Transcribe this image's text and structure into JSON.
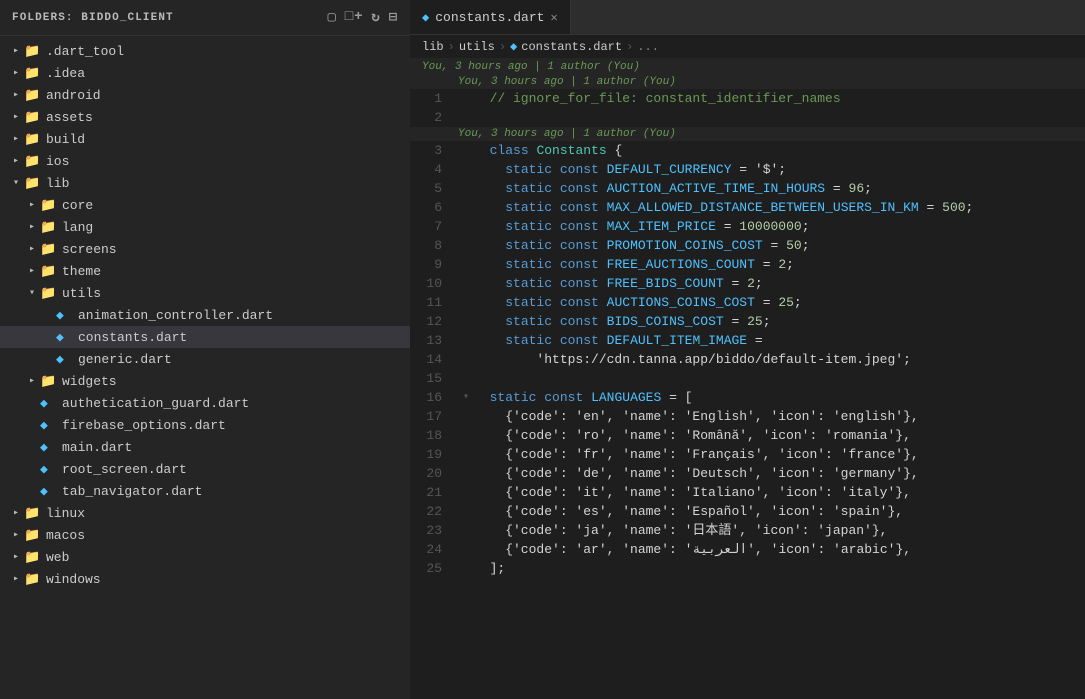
{
  "sidebar": {
    "header": "FOLDERS: BIDDO_CLIENT",
    "icons": [
      "new-file",
      "new-folder",
      "refresh",
      "collapse"
    ],
    "items": [
      {
        "id": "dart_tool",
        "label": ".dart_tool",
        "type": "folder",
        "level": 0,
        "expanded": false,
        "icon": "folder-yellow"
      },
      {
        "id": "idea",
        "label": ".idea",
        "type": "folder",
        "level": 0,
        "expanded": false,
        "icon": "folder-yellow"
      },
      {
        "id": "android",
        "label": "android",
        "type": "folder",
        "level": 0,
        "expanded": false,
        "icon": "folder-green"
      },
      {
        "id": "assets",
        "label": "assets",
        "type": "folder",
        "level": 0,
        "expanded": false,
        "icon": "folder-orange"
      },
      {
        "id": "build",
        "label": "build",
        "type": "folder",
        "level": 0,
        "expanded": false,
        "icon": "folder-yellow"
      },
      {
        "id": "ios",
        "label": "ios",
        "type": "folder",
        "level": 0,
        "expanded": false,
        "icon": "folder-blue"
      },
      {
        "id": "lib",
        "label": "lib",
        "type": "folder",
        "level": 0,
        "expanded": true,
        "icon": "folder-yellow"
      },
      {
        "id": "core",
        "label": "core",
        "type": "folder",
        "level": 1,
        "expanded": false,
        "icon": "folder-yellow"
      },
      {
        "id": "lang",
        "label": "lang",
        "type": "folder",
        "level": 1,
        "expanded": false,
        "icon": "folder-orange"
      },
      {
        "id": "screens",
        "label": "screens",
        "type": "folder",
        "level": 1,
        "expanded": false,
        "icon": "folder-orange"
      },
      {
        "id": "theme",
        "label": "theme",
        "type": "folder",
        "level": 1,
        "expanded": false,
        "icon": "folder-orange"
      },
      {
        "id": "utils",
        "label": "utils",
        "type": "folder",
        "level": 1,
        "expanded": true,
        "icon": "folder-orange"
      },
      {
        "id": "animation_controller",
        "label": "animation_controller.dart",
        "type": "file",
        "level": 2,
        "icon": "dart"
      },
      {
        "id": "constants",
        "label": "constants.dart",
        "type": "file",
        "level": 2,
        "icon": "dart",
        "active": true
      },
      {
        "id": "generic",
        "label": "generic.dart",
        "type": "file",
        "level": 2,
        "icon": "dart"
      },
      {
        "id": "widgets",
        "label": "widgets",
        "type": "folder",
        "level": 1,
        "expanded": false,
        "icon": "folder-orange"
      },
      {
        "id": "authetication_guard",
        "label": "authetication_guard.dart",
        "type": "file",
        "level": 1,
        "icon": "dart"
      },
      {
        "id": "firebase_options",
        "label": "firebase_options.dart",
        "type": "file",
        "level": 1,
        "icon": "dart"
      },
      {
        "id": "main",
        "label": "main.dart",
        "type": "file",
        "level": 1,
        "icon": "dart"
      },
      {
        "id": "root_screen",
        "label": "root_screen.dart",
        "type": "file",
        "level": 1,
        "icon": "dart"
      },
      {
        "id": "tab_navigator",
        "label": "tab_navigator.dart",
        "type": "file",
        "level": 1,
        "icon": "dart"
      },
      {
        "id": "linux",
        "label": "linux",
        "type": "folder",
        "level": 0,
        "expanded": false,
        "icon": "folder-yellow"
      },
      {
        "id": "macos",
        "label": "macos",
        "type": "folder",
        "level": 0,
        "expanded": false,
        "icon": "folder-yellow"
      },
      {
        "id": "web",
        "label": "web",
        "type": "folder",
        "level": 0,
        "expanded": false,
        "icon": "folder-blue"
      },
      {
        "id": "windows",
        "label": "windows",
        "type": "folder",
        "level": 0,
        "expanded": false,
        "icon": "folder-yellow"
      }
    ]
  },
  "editor": {
    "tab_name": "constants.dart",
    "breadcrumb": [
      "lib",
      "utils",
      "constants.dart",
      "..."
    ],
    "blame": "You, 3 hours ago | 1 author (You)",
    "blame2": "You, 3 hours ago | 1 author (You)",
    "lines": [
      {
        "num": 1,
        "content": "  // ignore_for_file: constant_identifier_names"
      },
      {
        "num": 2,
        "content": ""
      },
      {
        "num": 3,
        "content": "  class Constants {",
        "blame": "You, 3 hours ago | 1 author (You)"
      },
      {
        "num": 4,
        "content": "    static const DEFAULT_CURRENCY = '$';"
      },
      {
        "num": 5,
        "content": "    static const AUCTION_ACTIVE_TIME_IN_HOURS = 96;"
      },
      {
        "num": 6,
        "content": "    static const MAX_ALLOWED_DISTANCE_BETWEEN_USERS_IN_KM = 500;"
      },
      {
        "num": 7,
        "content": "    static const MAX_ITEM_PRICE = 10000000;"
      },
      {
        "num": 8,
        "content": "    static const PROMOTION_COINS_COST = 50;"
      },
      {
        "num": 9,
        "content": "    static const FREE_AUCTIONS_COUNT = 2;"
      },
      {
        "num": 10,
        "content": "    static const FREE_BIDS_COUNT = 2;"
      },
      {
        "num": 11,
        "content": "    static const AUCTIONS_COINS_COST = 25;"
      },
      {
        "num": 12,
        "content": "    static const BIDS_COINS_COST = 25;"
      },
      {
        "num": 13,
        "content": "    static const DEFAULT_ITEM_IMAGE ="
      },
      {
        "num": 14,
        "content": "        'https://cdn.tanna.app/biddo/default-item.jpeg';"
      },
      {
        "num": 15,
        "content": ""
      },
      {
        "num": 16,
        "content": "  static const LANGUAGES = [",
        "fold": true
      },
      {
        "num": 17,
        "content": "    {'code': 'en', 'name': 'English', 'icon': 'english'},"
      },
      {
        "num": 18,
        "content": "    {'code': 'ro', 'name': 'Română', 'icon': 'romania'},"
      },
      {
        "num": 19,
        "content": "    {'code': 'fr', 'name': 'Français', 'icon': 'france'},"
      },
      {
        "num": 20,
        "content": "    {'code': 'de', 'name': 'Deutsch', 'icon': 'germany'},"
      },
      {
        "num": 21,
        "content": "    {'code': 'it', 'name': 'Italiano', 'icon': 'italy'},"
      },
      {
        "num": 22,
        "content": "    {'code': 'es', 'name': 'Español', 'icon': 'spain'},"
      },
      {
        "num": 23,
        "content": "    {'code': 'ja', 'name': '日本語', 'icon': 'japan'},"
      },
      {
        "num": 24,
        "content": "    {'code': 'ar', 'name': 'العربية', 'icon': 'arabic'},"
      },
      {
        "num": 25,
        "content": "  ];"
      }
    ]
  }
}
